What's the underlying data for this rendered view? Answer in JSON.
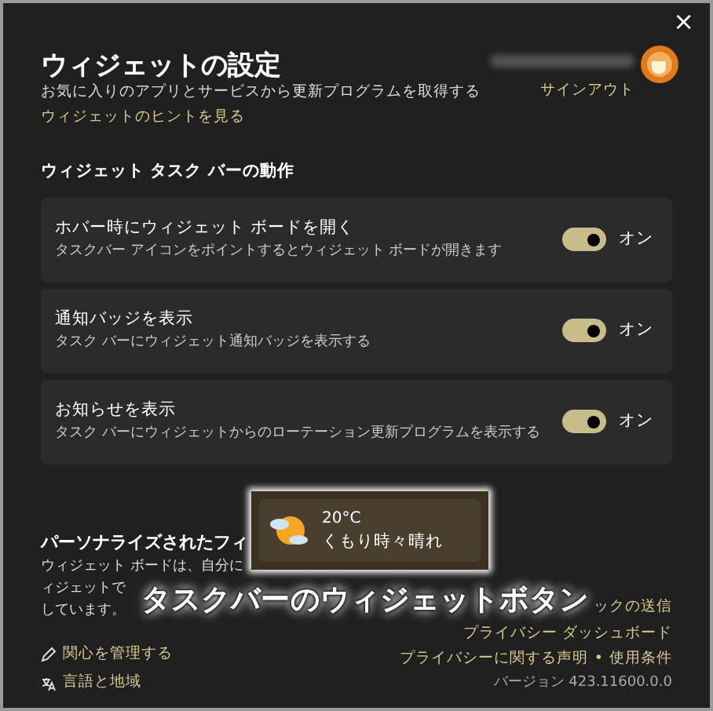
{
  "window": {
    "close": "×"
  },
  "header": {
    "title": "ウィジェットの設定",
    "subtitle": "お気に入りのアプリとサービスから更新プログラムを取得する",
    "tips_link": "ウィジェットのヒントを見る"
  },
  "account": {
    "action": "サインアウト"
  },
  "section_title": "ウィジェット タスク バーの動作",
  "settings": [
    {
      "title": "ホバー時にウィジェット ボードを開く",
      "description": "タスクバー アイコンをポイントするとウィジェット ボードが開きます",
      "on": true,
      "state_label": "オン"
    },
    {
      "title": "通知バッジを表示",
      "description": "タスク バーにウィジェット通知バッジを表示する",
      "on": true,
      "state_label": "オン"
    },
    {
      "title": "お知らせを表示",
      "description": "タスク バーにウィジェットからのローテーション更新プログラムを表示する",
      "on": true,
      "state_label": "オン"
    }
  ],
  "personalization": {
    "title": "パーソナライズされたフィ",
    "lines": [
      [
        "ウィジェット ボードは、自分に"
      ],
      [
        "ィジェットで"
      ],
      [
        "しています。"
      ]
    ]
  },
  "left_links": [
    {
      "kind": "pencil",
      "label": "関心を管理する"
    },
    {
      "kind": "language",
      "label": "言語と地域"
    }
  ],
  "link_separator": "•",
  "right_links": [
    [
      "ックの送信"
    ],
    [
      "プライバシー ダッシュボード"
    ],
    [
      "プライバシーに関する声明",
      "使用条件"
    ]
  ],
  "version": "バージョン 423.11600.0.0",
  "weather_popup": {
    "temperature": "20°C",
    "condition": "くもり時々晴れ"
  },
  "caption": "タスクバーのウィジェットボタン"
}
